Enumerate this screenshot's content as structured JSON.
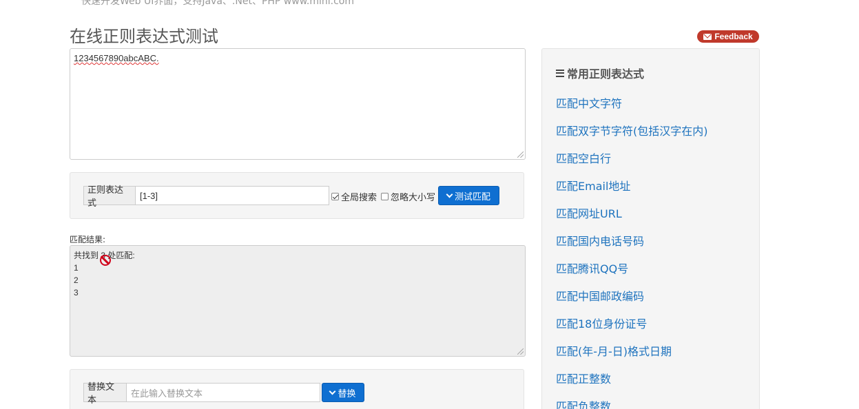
{
  "header": {
    "top_text": "快速开发Web UI界面，支持Java、.Net、PHP www.mini.com",
    "title": "在线正则表达式测试",
    "feedback_label": "Feedback"
  },
  "source": {
    "text": "1234567890abcABC."
  },
  "regex": {
    "addon_label": "正则表达式",
    "value": "[1-3]",
    "global_label": "全局搜索",
    "global_checked": true,
    "ignorecase_label": "忽略大小写",
    "ignorecase_checked": false,
    "test_button": "测试匹配"
  },
  "result": {
    "label": "匹配结果:",
    "summary": "共找到 3 处匹配:",
    "matches": [
      "1",
      "2",
      "3"
    ]
  },
  "replace": {
    "addon_label": "替换文本",
    "placeholder": "在此输入替换文本",
    "button": "替换"
  },
  "sidebar": {
    "heading": "常用正则表达式",
    "links": [
      "匹配中文字符",
      "匹配双字节字符(包括汉字在内)",
      "匹配空白行",
      "匹配Email地址",
      "匹配网址URL",
      "匹配国内电话号码",
      "匹配腾讯QQ号",
      "匹配中国邮政编码",
      "匹配18位身份证号",
      "匹配(年-月-日)格式日期",
      "匹配正整数",
      "匹配负整数"
    ]
  },
  "colors": {
    "link": "#1e73be",
    "primary_button": "#0f6fd1",
    "feedback_badge": "#c0392b",
    "cursor_icon": "#d0021b"
  },
  "icons": [
    "mail-icon",
    "chevron-down-icon",
    "list-icon",
    "not-allowed-cursor-icon"
  ]
}
